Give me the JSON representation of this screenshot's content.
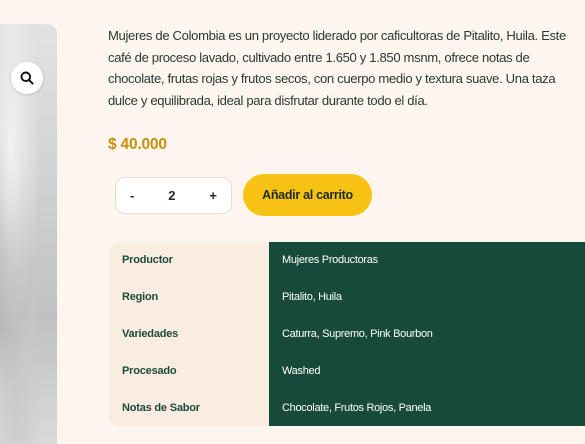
{
  "product": {
    "description": "Mujeres de Colombia es un proyecto liderado por caficultoras de Pitalito, Huila. Este café de proceso lavado, cultivado entre 1.650 y 1.850 msnm, ofrece notas de chocolate, frutas rojas y frutos secos, con cuerpo medio y textura suave. Una taza dulce y equilibrada, ideal para disfrutar durante todo el día.",
    "price": "$ 40.000"
  },
  "gallery": {
    "zoom_icon": "search-icon"
  },
  "quantity": {
    "decrement_label": "-",
    "value": "2",
    "increment_label": "+"
  },
  "cart": {
    "add_label": "Añadir al carrito"
  },
  "colors": {
    "background": "#fdf6ee",
    "price": "#c78f0c",
    "cart_button": "#f6c315",
    "spec_label_bg": "#f9ece0",
    "spec_value_bg": "#174a3a",
    "spec_label_text": "#1c4a3a"
  },
  "specs": [
    {
      "label": "Productor",
      "value": "Mujeres Productoras"
    },
    {
      "label": "Region",
      "value": "Pitalito, Huila"
    },
    {
      "label": "Variedades",
      "value": "Caturra, Supremo, Pink Bourbon"
    },
    {
      "label": "Procesado",
      "value": "Washed"
    },
    {
      "label": "Notas de Sabor",
      "value": "Chocolate, Frutos Rojos, Panela"
    }
  ]
}
